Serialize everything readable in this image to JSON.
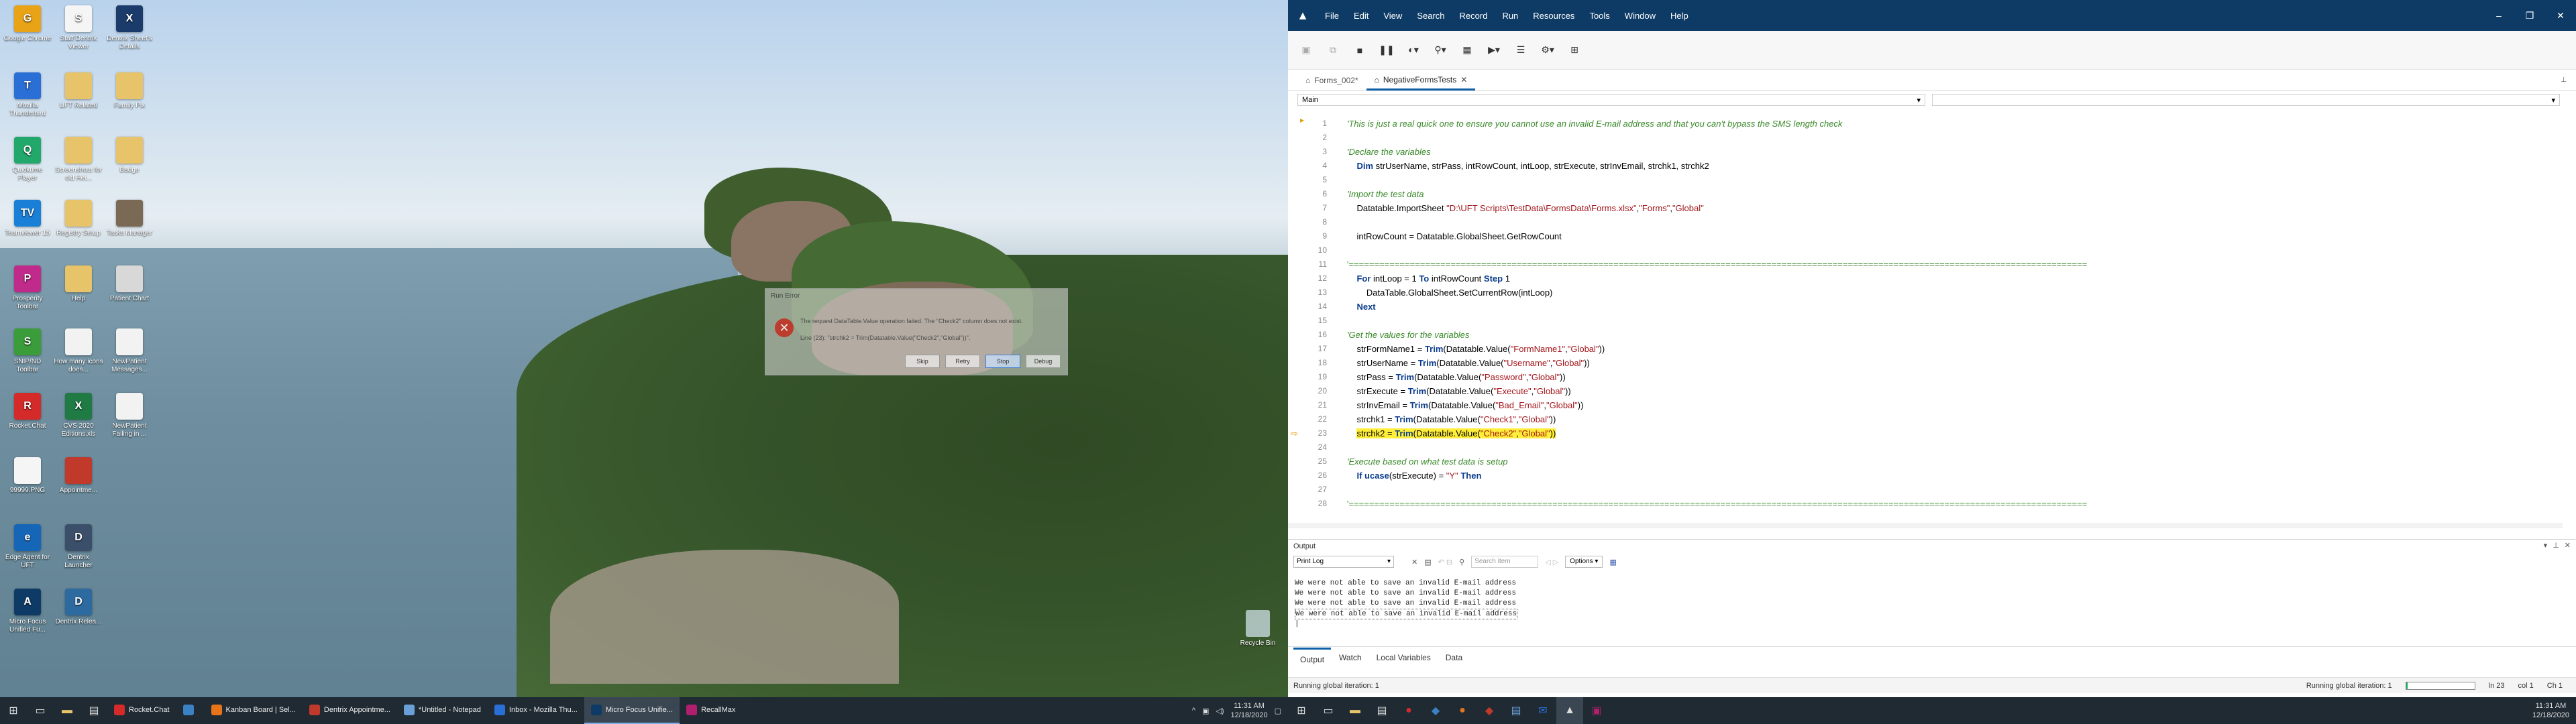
{
  "desktop": {
    "icons": [
      {
        "label": "Google Chrome",
        "color": "#e8a317",
        "glyph": "G"
      },
      {
        "label": "Staff Dentrix Viewer",
        "color": "#f5f5f5",
        "glyph": "S"
      },
      {
        "label": "Dentrix Sheet's Details",
        "color": "#1b3c6a",
        "glyph": "X"
      },
      {
        "label": "Mozilla Thunderbird",
        "color": "#2a6fd6",
        "glyph": "T"
      },
      {
        "label": "UFT Related",
        "color": "#e7c46a",
        "glyph": ""
      },
      {
        "label": "Family Pix",
        "color": "#e7c46a",
        "glyph": ""
      },
      {
        "label": "Quicktime Player",
        "color": "#22a86b",
        "glyph": "Q"
      },
      {
        "label": "Screenshots for old Hei...",
        "color": "#e7c46a",
        "glyph": ""
      },
      {
        "label": "Badge",
        "color": "#e7c46a",
        "glyph": ""
      },
      {
        "label": "Teamviewer 15",
        "color": "#1a7fd6",
        "glyph": "TV"
      },
      {
        "label": "Registry Setup",
        "color": "#e7c46a",
        "glyph": ""
      },
      {
        "label": "Tasks Manager",
        "color": "#7a6a55",
        "glyph": ""
      },
      {
        "label": "Prosperity Toolbar",
        "color": "#c02a8a",
        "glyph": "P"
      },
      {
        "label": "Help",
        "color": "#e7c46a",
        "glyph": ""
      },
      {
        "label": "Patient Chart",
        "color": "#d8d8d8",
        "glyph": ""
      },
      {
        "label": "SNIP/ND Toolbar",
        "color": "#3a9d3a",
        "glyph": "S"
      },
      {
        "label": "How many icons does...",
        "color": "#f2f2f2",
        "glyph": ""
      },
      {
        "label": "NewPatient Messages...",
        "color": "#f2f2f2",
        "glyph": ""
      },
      {
        "label": "Rocket.Chat",
        "color": "#d42a2a",
        "glyph": "R"
      },
      {
        "label": "CVS 2020 Editions.xls",
        "color": "#1f7a44",
        "glyph": "X"
      },
      {
        "label": "NewPatient Failing in ...",
        "color": "#f2f2f2",
        "glyph": ""
      },
      {
        "label": "99999.PNG",
        "color": "#f5f5f5",
        "glyph": ""
      },
      {
        "label": "Appointme...",
        "color": "#c0392b",
        "glyph": ""
      },
      {
        "label": "Edge Agent for UFT",
        "color": "#1566b7",
        "glyph": "e"
      },
      {
        "label": "Dentrix Launcher",
        "color": "#3b4f6a",
        "glyph": "D"
      },
      {
        "label": "Micro Focus Unified Fu...",
        "color": "#0d3b66",
        "glyph": "A"
      },
      {
        "label": "Dentrix Relea...",
        "color": "#2d6aa0",
        "glyph": "D"
      }
    ],
    "recycle_bin": "Recycle Bin",
    "run_error": {
      "title": "Run Error",
      "message": "The request DataTable.Value operation failed. The \"Check2\" column does not exist.",
      "line": "Line (23): \"strchk2 = Trim(Datatable.Value(\"Check2\",\"Global\"))\".",
      "buttons": [
        "Skip",
        "Retry",
        "Stop",
        "Debug"
      ]
    },
    "taskbar": {
      "apps": [
        {
          "label": "Rocket.Chat",
          "color": "#d42a2a"
        },
        {
          "label": "",
          "color": "#3b82c4"
        },
        {
          "label": "Kanban Board | Sel...",
          "color": "#e8741a"
        },
        {
          "label": "Dentrix Appointme...",
          "color": "#c0392b"
        },
        {
          "label": "*Untitled - Notepad",
          "color": "#6aa0d8"
        },
        {
          "label": "Inbox - Mozilla Thu...",
          "color": "#2a6fd6"
        },
        {
          "label": "Micro Focus Unifie...",
          "color": "#0d3b66"
        },
        {
          "label": "RecallMax",
          "color": "#b01f6e"
        }
      ],
      "time": "11:31 AM",
      "date": "12/18/2020"
    }
  },
  "uft": {
    "menu": [
      "File",
      "Edit",
      "View",
      "Search",
      "Record",
      "Run",
      "Resources",
      "Tools",
      "Window",
      "Help"
    ],
    "tabs": [
      {
        "label": "Forms_002*",
        "active": false
      },
      {
        "label": "NegativeFormsTests",
        "active": true
      }
    ],
    "action_selector": "Main",
    "code_lines": [
      {
        "n": "1",
        "html": "<span class='cm'>'This is just a real quick one to ensure you cannot use an invalid E-mail address and that you can't bypass the SMS length check</span>"
      },
      {
        "n": "2",
        "html": ""
      },
      {
        "n": "3",
        "html": "<span class='cm'>'Declare the variables</span>"
      },
      {
        "n": "4",
        "html": "    <span class='kw'>Dim</span> strUserName, strPass, intRowCount, intLoop, strExecute, strInvEmail, strchk1, strchk2"
      },
      {
        "n": "5",
        "html": ""
      },
      {
        "n": "6",
        "html": "<span class='cm'>'Import the test data</span>"
      },
      {
        "n": "7",
        "html": "    Datatable.ImportSheet <span class='str'>\"D:\\UFT Scripts\\TestData\\FormsData\\Forms.xlsx\"</span>,<span class='str'>\"Forms\"</span>,<span class='str'>\"Global\"</span>"
      },
      {
        "n": "8",
        "html": ""
      },
      {
        "n": "9",
        "html": "    intRowCount = Datatable.GlobalSheet.GetRowCount"
      },
      {
        "n": "10",
        "html": ""
      },
      {
        "n": "11",
        "html": "<span class='eq'>'=================================================================================================================================================</span>"
      },
      {
        "n": "12",
        "html": "    <span class='kw'>For</span> intLoop = 1 <span class='kw'>To</span> intRowCount <span class='kw'>Step</span> 1"
      },
      {
        "n": "13",
        "html": "        DataTable.GlobalSheet.SetCurrentRow(intLoop)"
      },
      {
        "n": "14",
        "html": "    <span class='kw'>Next</span>"
      },
      {
        "n": "15",
        "html": ""
      },
      {
        "n": "16",
        "html": "<span class='cm'>'Get the values for the variables</span>"
      },
      {
        "n": "17",
        "html": "    strFormName1 = <span class='fn'>Trim</span>(Datatable.Value(<span class='str'>\"FormName1\"</span>,<span class='str'>\"Global\"</span>))"
      },
      {
        "n": "18",
        "html": "    strUserName = <span class='fn'>Trim</span>(Datatable.Value(<span class='str'>\"Username\"</span>,<span class='str'>\"Global\"</span>))"
      },
      {
        "n": "19",
        "html": "    strPass = <span class='fn'>Trim</span>(Datatable.Value(<span class='str'>\"Password\"</span>,<span class='str'>\"Global\"</span>))"
      },
      {
        "n": "20",
        "html": "    strExecute = <span class='fn'>Trim</span>(Datatable.Value(<span class='str'>\"Execute\"</span>,<span class='str'>\"Global\"</span>))"
      },
      {
        "n": "21",
        "html": "    strInvEmail = <span class='fn'>Trim</span>(Datatable.Value(<span class='str'>\"Bad_Email\"</span>,<span class='str'>\"Global\"</span>))"
      },
      {
        "n": "22",
        "html": "    strchk1 = <span class='fn'>Trim</span>(Datatable.Value(<span class='str'>\"Check1\"</span>,<span class='str'>\"Global\"</span>))"
      },
      {
        "n": "23",
        "html": "    <span class='hl'>strchk2 = <span class='fn'>Trim</span>(Datatable.Value(<span class='str'>\"Check2\"</span>,<span class='str'>\"Global\"</span>))</span>",
        "current": true
      },
      {
        "n": "24",
        "html": ""
      },
      {
        "n": "25",
        "html": "<span class='cm'>'Execute based on what test data is setup</span>"
      },
      {
        "n": "26",
        "html": "    <span class='kw'>If</span> <span class='fn'>ucase</span>(strExecute) = <span class='str'>\"Y\"</span> <span class='kw'>Then</span>"
      },
      {
        "n": "27",
        "html": ""
      },
      {
        "n": "28",
        "html": "<span class='eq'>'=================================================================================================================================================</span>"
      }
    ],
    "output": {
      "title": "Output",
      "log_select": "Print Log",
      "search_placeholder": "Search item",
      "options_label": "Options",
      "lines": [
        "We were not able to save an invalid E-mail address",
        "We were not able to save an invalid E-mail address",
        "We were not able to save an invalid E-mail address",
        "We were not able to save an invalid E-mail address"
      ]
    },
    "bottom_tabs": [
      "Output",
      "Watch",
      "Local Variables",
      "Data"
    ],
    "status": {
      "left": "Running global iteration: 1",
      "right": "Running global iteration: 1",
      "progress": 0.02,
      "line": "ln 23",
      "col": "col 1",
      "ch": "Ch 1"
    },
    "taskbar_time": "11:31 AM",
    "taskbar_date": "12/18/2020"
  }
}
